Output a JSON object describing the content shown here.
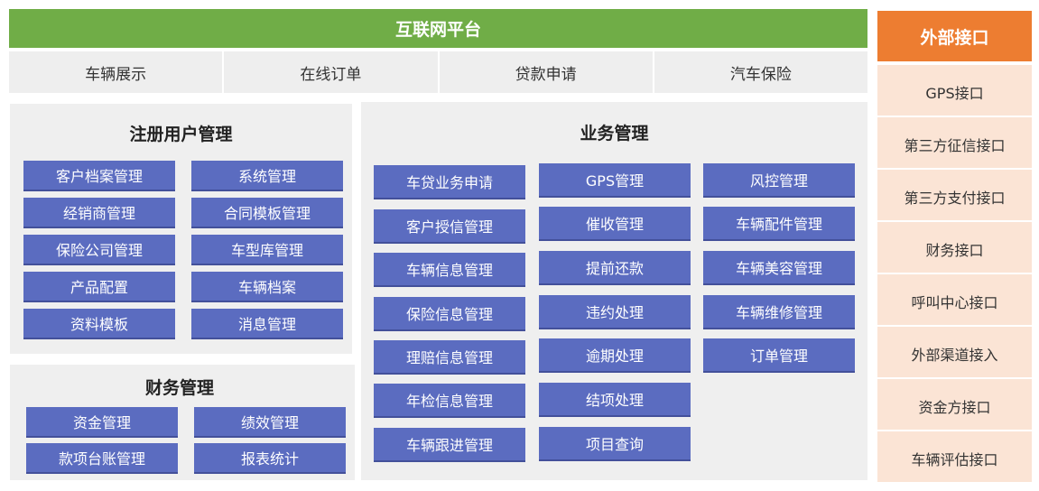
{
  "platform": {
    "title": "互联网平台",
    "channels": [
      "车辆展示",
      "在线订单",
      "贷款申请",
      "汽车保险"
    ]
  },
  "user_mgmt": {
    "title": "注册用户管理",
    "left": [
      "客户档案管理",
      "经销商管理",
      "保险公司管理",
      "产品配置",
      "资料模板"
    ],
    "right": [
      "系统管理",
      "合同模板管理",
      "车型库管理",
      "车辆档案",
      "消息管理"
    ]
  },
  "finance_mgmt": {
    "title": "财务管理",
    "left": [
      "资金管理",
      "款项台账管理"
    ],
    "right": [
      "绩效管理",
      "报表统计"
    ]
  },
  "business_mgmt": {
    "title": "业务管理",
    "col1": [
      "车贷业务申请",
      "客户授信管理",
      "车辆信息管理",
      "保险信息管理",
      "理赔信息管理",
      "年检信息管理",
      "车辆跟进管理"
    ],
    "col2": [
      "GPS管理",
      "催收管理",
      "提前还款",
      "违约处理",
      "逾期处理",
      "结项处理",
      "项目查询"
    ],
    "col3": [
      "风控管理",
      "车辆配件管理",
      "车辆美容管理",
      "车辆维修管理",
      "订单管理"
    ]
  },
  "external": {
    "title": "外部接口",
    "items": [
      "GPS接口",
      "第三方征信接口",
      "第三方支付接口",
      "财务接口",
      "呼叫中心接口",
      "外部渠道接入",
      "资金方接口",
      "车辆评估接口"
    ]
  },
  "colors": {
    "platform_bar": "#70ad47",
    "module_box": "#5b6cc0",
    "external_header": "#ed7d31",
    "external_body": "#fbe4d5",
    "panel_bg": "#efefef"
  }
}
